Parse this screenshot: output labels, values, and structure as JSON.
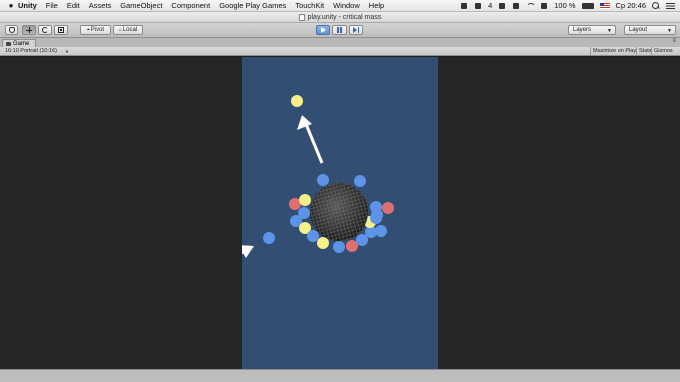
{
  "menubar": {
    "app": "Unity",
    "items": [
      "File",
      "Edit",
      "Assets",
      "GameObject",
      "Component",
      "Google Play Games",
      "TouchKit",
      "Window",
      "Help"
    ],
    "status": {
      "badge": "4",
      "battery": "100 %",
      "clock": "Cp 20:46"
    }
  },
  "window": {
    "title": "play.unity - critical mass"
  },
  "toolbar": {
    "pivot_label": "Pivot",
    "local_label": "Local",
    "layers_label": "Layers",
    "layout_label": "Layout"
  },
  "game_panel": {
    "tab_label": "Game",
    "aspect_label": "16:10 Portrait (10:16)",
    "maximize_label": "Maximize on Play",
    "stats_label": "Stats",
    "gizmos_label": "Gizmos"
  },
  "colors": {
    "game_background": "#334e73",
    "orb_blue": "#5e94e8",
    "orb_yellow": "#f5f08a",
    "orb_red": "#e07070",
    "arrow": "#ffffff",
    "core_dark": "#262626"
  },
  "scene": {
    "core": {
      "kind": "dark-cellular-sphere"
    },
    "launched_orb": {
      "color": "yellow"
    },
    "incoming_orb": {
      "color": "blue"
    },
    "ring_orbs": [
      "blue",
      "blue",
      "red",
      "yellow",
      "blue",
      "blue",
      "yellow",
      "blue",
      "yellow",
      "blue",
      "red",
      "blue",
      "blue",
      "blue",
      "yellow",
      "blue",
      "blue",
      "red",
      "blue"
    ]
  }
}
